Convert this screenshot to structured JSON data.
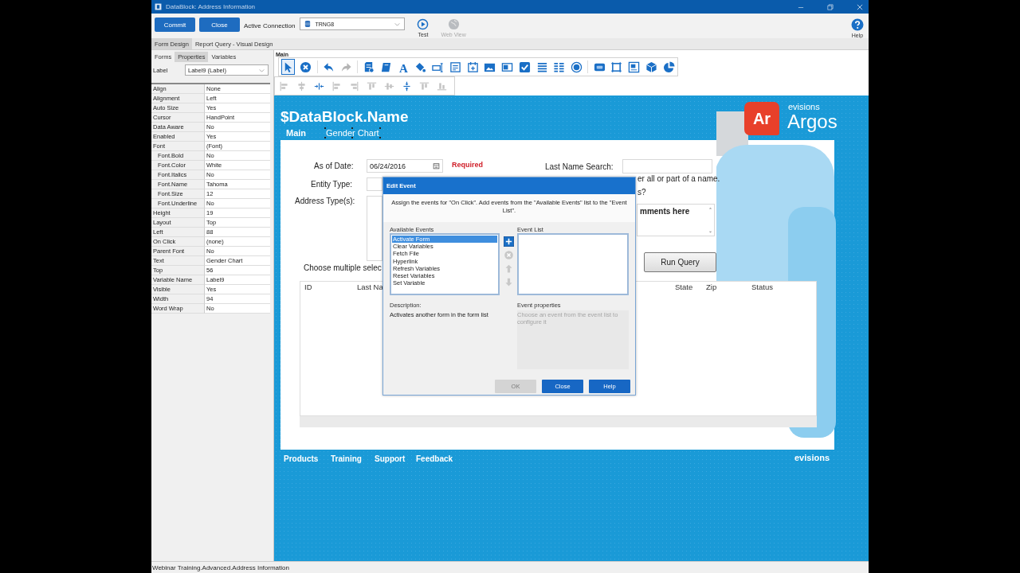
{
  "window": {
    "title": "DataBlock: Address Information"
  },
  "ribbon": {
    "buttons": [
      {
        "label": "Commit"
      },
      {
        "label": "Close"
      }
    ],
    "connection": {
      "label": "Active Connection",
      "value": "TRNG8"
    },
    "tools": [
      {
        "kind": "play",
        "label": "Test",
        "disabled": false
      },
      {
        "kind": "globe",
        "label": "Web View",
        "disabled": true
      }
    ],
    "help": {
      "label": "Help"
    }
  },
  "designer_tabs": [
    {
      "label": "Form Design",
      "selected": true
    },
    {
      "label": "Report Query - Visual Design",
      "selected": false
    }
  ],
  "panel_tabs": [
    {
      "label": "Forms",
      "selected": false
    },
    {
      "label": "Properties",
      "selected": true
    },
    {
      "label": "Variables",
      "selected": false
    }
  ],
  "component": {
    "label": "Label",
    "value": "Label9 (Label)"
  },
  "properties": [
    {
      "name": "Align",
      "value": "None"
    },
    {
      "name": "Alignment",
      "value": "Left"
    },
    {
      "name": "Auto Size",
      "value": "Yes"
    },
    {
      "name": "Cursor",
      "value": "HandPoint"
    },
    {
      "name": "Data Aware",
      "value": "No"
    },
    {
      "name": "Enabled",
      "value": "Yes"
    },
    {
      "name": "Font",
      "value": "(Font)",
      "children": [
        {
          "name": "Font.Bold",
          "value": "No"
        },
        {
          "name": "Font.Color",
          "value": "White"
        },
        {
          "name": "Font.Italics",
          "value": "No"
        },
        {
          "name": "Font.Name",
          "value": "Tahoma"
        },
        {
          "name": "Font.Size",
          "value": "12"
        },
        {
          "name": "Font.Underline",
          "value": "No"
        }
      ]
    },
    {
      "name": "Height",
      "value": "19"
    },
    {
      "name": "Layout",
      "value": "Top"
    },
    {
      "name": "Left",
      "value": "88"
    },
    {
      "name": "On Click",
      "value": "(none)"
    },
    {
      "name": "Parent Font",
      "value": "No"
    },
    {
      "name": "Text",
      "value": "Gender Chart"
    },
    {
      "name": "Top",
      "value": "56"
    },
    {
      "name": "Variable Name",
      "value": "Label9"
    },
    {
      "name": "Visible",
      "value": "Yes"
    },
    {
      "name": "Width",
      "value": "94"
    },
    {
      "name": "Word Wrap",
      "value": "No"
    }
  ],
  "main_toolbar": {
    "title": "Main",
    "tools": [
      {
        "kind": "pointer",
        "selected": true
      },
      {
        "kind": "delete",
        "selected": false
      },
      {
        "kind": "undo",
        "selected": false
      },
      {
        "kind": "redo",
        "selected": false,
        "disabled": true
      },
      {
        "kind": "database",
        "selected": false
      },
      {
        "kind": "book",
        "selected": false
      },
      {
        "kind": "text",
        "glyph": "A",
        "selected": false
      },
      {
        "kind": "paint",
        "selected": false
      },
      {
        "kind": "edit",
        "selected": false
      },
      {
        "kind": "memo",
        "selected": false
      },
      {
        "kind": "calendar",
        "selected": false
      },
      {
        "kind": "image",
        "selected": false
      },
      {
        "kind": "toggle",
        "selected": false
      },
      {
        "kind": "checkbox",
        "selected": false
      },
      {
        "kind": "list",
        "selected": false
      },
      {
        "kind": "grid",
        "selected": false
      },
      {
        "kind": "radio",
        "selected": false
      },
      {
        "kind": "go",
        "selected": false
      },
      {
        "kind": "frame",
        "selected": false
      },
      {
        "kind": "panel",
        "selected": false
      },
      {
        "kind": "cube",
        "selected": false
      },
      {
        "kind": "pie",
        "selected": false
      }
    ]
  },
  "align_toolbar": [
    {
      "kind": "align-left",
      "disabled": true
    },
    {
      "kind": "align-center",
      "disabled": true
    },
    {
      "kind": "center-h",
      "disabled": false
    },
    {
      "kind": "align-left",
      "disabled": true
    },
    {
      "kind": "align-right",
      "disabled": true
    },
    {
      "kind": "align-top",
      "disabled": true
    },
    {
      "kind": "align-middle",
      "disabled": true
    },
    {
      "kind": "center-v",
      "disabled": false
    },
    {
      "kind": "align-top",
      "disabled": true
    },
    {
      "kind": "align-bottom",
      "disabled": true
    }
  ],
  "form": {
    "title": "$DataBlock.Name",
    "tabs": [
      {
        "label": "Main",
        "selected": false
      },
      {
        "label": "Gender Chart",
        "selected": true
      }
    ],
    "logo": {
      "mark": "Ar",
      "brand": "evisions",
      "product": "Argos"
    },
    "as_of_date": {
      "label": "As of Date:",
      "value": "06/24/2016",
      "note": "Required"
    },
    "last_name_search": {
      "label": "Last Name Search:"
    },
    "entity_type": {
      "label": "Entity Type:"
    },
    "hints": [
      "er all or part of a name.",
      "s?"
    ],
    "address_types": {
      "label": "Address Type(s):"
    },
    "comments": {
      "value": "mments here"
    },
    "run_query": {
      "label": "Run Query"
    },
    "choose_text": "Choose multiple selec",
    "results": {
      "columns": [
        "ID",
        "Last Na",
        "State",
        "Zip",
        "Status"
      ]
    },
    "footer_links": [
      "Products",
      "Training",
      "Support",
      "Feedback"
    ],
    "footer_brand": "evisions"
  },
  "dialog": {
    "title": "Edit Event",
    "instructions": "Assign the events for \"On Click\".  Add events from the \"Available Events\" list to the \"Event List\".",
    "available_label": "Available Events",
    "available": [
      {
        "label": "Activate Form",
        "selected": true
      },
      {
        "label": "Clear Variables",
        "selected": false
      },
      {
        "label": "Fetch File",
        "selected": false
      },
      {
        "label": "Hyperlink",
        "selected": false
      },
      {
        "label": "Refresh Variables",
        "selected": false
      },
      {
        "label": "Reset Variables",
        "selected": false
      },
      {
        "label": "Set Variable",
        "selected": false
      }
    ],
    "move_buttons": [
      {
        "kind": "add",
        "disabled": false
      },
      {
        "kind": "remove",
        "disabled": true
      },
      {
        "kind": "up",
        "disabled": true
      },
      {
        "kind": "down",
        "disabled": true
      }
    ],
    "event_list_label": "Event List",
    "description_label": "Description:",
    "description": "Activates another form in the form list",
    "properties_label": "Event properties",
    "properties_hint": "Choose an event from the event list to configure it",
    "buttons": [
      {
        "label": "OK",
        "disabled": true
      },
      {
        "label": "Close",
        "disabled": false
      },
      {
        "label": "Help",
        "disabled": false
      }
    ]
  },
  "status_bar": "Webinar Training.Advanced.Address Information"
}
